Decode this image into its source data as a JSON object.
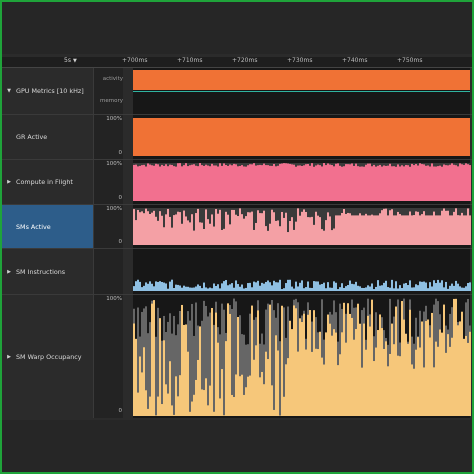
{
  "ruler": {
    "unit_select": "5s",
    "ticks": [
      "+700ms",
      "+710ms",
      "+720ms",
      "+730ms",
      "+740ms",
      "+750ms"
    ]
  },
  "rows": [
    {
      "label": "GPU Metrics [10 kHz]",
      "expander": true,
      "expanded": true,
      "sub": [
        "activity",
        "memory"
      ]
    },
    {
      "label": "GR Active",
      "expander": false,
      "scale_top": "100%",
      "scale_bottom": "0",
      "color": "#f07235",
      "level": 1.0
    },
    {
      "label": "Compute in Flight",
      "expander": true,
      "scale_top": "100%",
      "scale_bottom": "0",
      "color": "#f2708f",
      "level": 0.92
    },
    {
      "label": "SMs Active",
      "expander": false,
      "selected": true,
      "scale_top": "100%",
      "scale_bottom": "0",
      "color": "#f4a0a5",
      "level": 0.62
    },
    {
      "label": "SM Instructions",
      "expander": true,
      "scale_top": "",
      "scale_bottom": "",
      "color": "#8fc0e3",
      "level": 0.18
    },
    {
      "label": "SM Warp Occupancy",
      "expander": true,
      "scale_top": "100%",
      "scale_bottom": "0",
      "color": "#f6c77a",
      "level": 0.4
    }
  ],
  "colors": {
    "selection": "#2d5d8a",
    "border": "#1fa33a",
    "activity": "#f07235",
    "background_fill": "#666666"
  }
}
